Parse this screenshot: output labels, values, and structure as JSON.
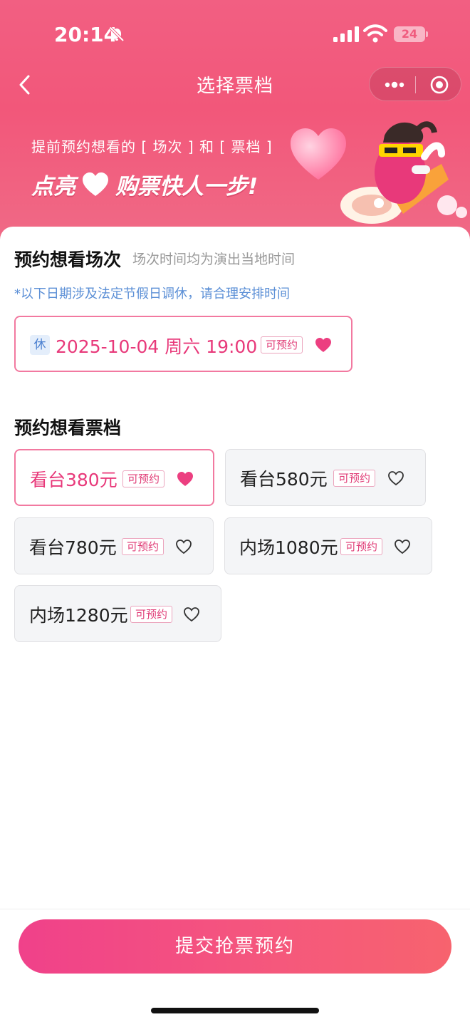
{
  "status_bar": {
    "time": "20:14",
    "battery": "24",
    "icons": [
      "bell-slash-icon",
      "signal-icon",
      "wifi-icon",
      "battery-icon"
    ]
  },
  "nav": {
    "title": "选择票档",
    "back_icon": "chevron-left-icon",
    "more_icon": "more-dots-icon",
    "close_icon": "target-close-icon"
  },
  "banner": {
    "line1": "提前预约想看的 [ 场次 ] 和 [ 票档 ]",
    "line2_part1": "点亮",
    "line2_part2": "购票快人一步!"
  },
  "session_section": {
    "title": "预约想看场次",
    "subtitle": "场次时间均为演出当地时间",
    "notice": "*以下日期涉及法定节假日调休，请合理安排时间",
    "sessions": [
      {
        "holiday_tag": "休",
        "datetime": "2025-10-04 周六 19:00",
        "status": "可预约",
        "liked": true
      }
    ]
  },
  "tier_section": {
    "title": "预约想看票档",
    "tiers": [
      {
        "label": "看台380元",
        "status": "可预约",
        "liked": true
      },
      {
        "label": "看台580元",
        "status": "可预约",
        "liked": false
      },
      {
        "label": "看台780元",
        "status": "可预约",
        "liked": false
      },
      {
        "label": "内场1080元",
        "status": "可预约",
        "liked": false
      },
      {
        "label": "内场1280元",
        "status": "可预约",
        "liked": false
      }
    ]
  },
  "footer": {
    "submit_label": "提交抢票预约"
  },
  "colors": {
    "brand_pink": "#f25f82",
    "accent": "#e8397a",
    "notice_blue": "#5b8fd6"
  }
}
